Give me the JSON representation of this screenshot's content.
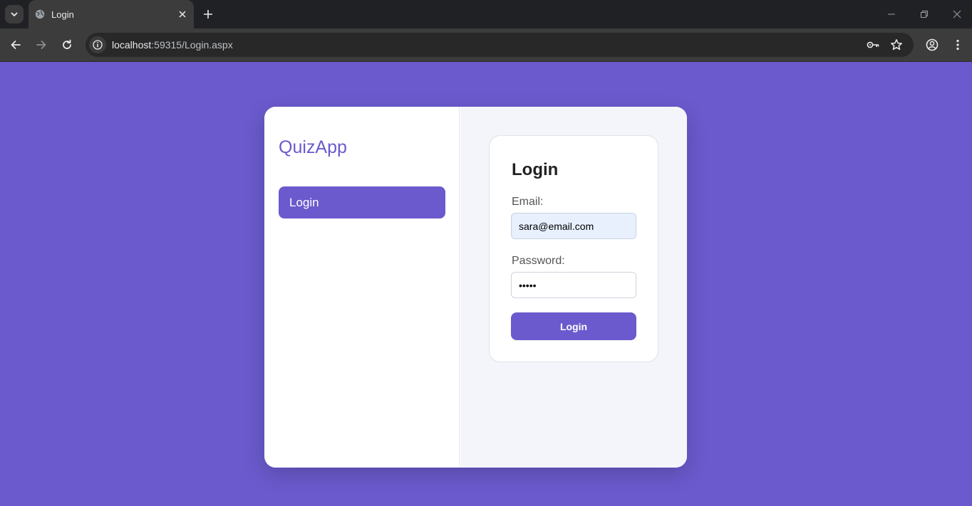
{
  "browser": {
    "tab_title": "Login",
    "url_host": "localhost",
    "url_path": ":59315/Login.aspx"
  },
  "sidebar": {
    "brand": "QuizApp",
    "nav_items": [
      {
        "label": "Login",
        "active": true
      }
    ]
  },
  "login_form": {
    "title": "Login",
    "email_label": "Email:",
    "email_value": "sara@email.com",
    "password_label": "Password:",
    "password_value": "•••••",
    "submit_label": "Login"
  },
  "colors": {
    "accent": "#6a5acd",
    "page_background": "#6a5acd",
    "panel_background": "#f3f5fb",
    "autofill_background": "#e8f0fe"
  }
}
